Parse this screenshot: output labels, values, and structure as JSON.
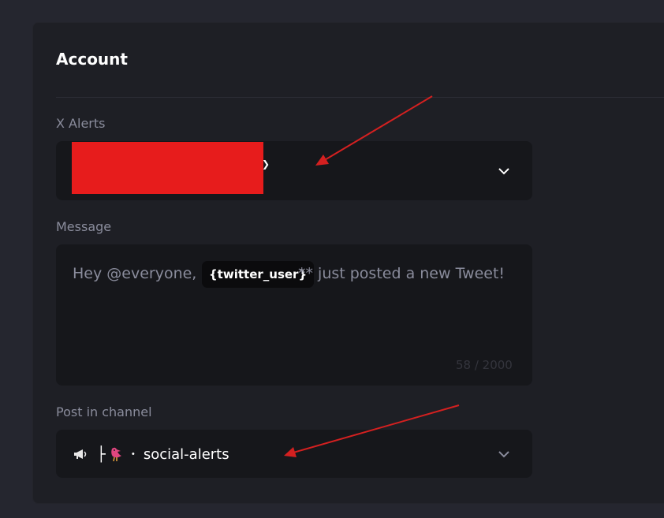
{
  "account": {
    "title": "Account"
  },
  "alerts": {
    "label": "X Alerts"
  },
  "message": {
    "label": "Message",
    "text_before": "Hey @everyone, **",
    "chip": "{twitter_user}",
    "text_after": "** just posted a new Tweet!",
    "counter": "58 / 2000"
  },
  "channel": {
    "label": "Post in channel",
    "prefix": "├",
    "separator": "・",
    "name": "social-alerts",
    "icons": [
      "megaphone-icon",
      "bird-icon"
    ]
  },
  "colors": {
    "background": "#25262f",
    "panel": "#1e1f25",
    "field": "#16171b",
    "annotation_arrow": "#d42020",
    "redaction": "#e71c1c"
  }
}
